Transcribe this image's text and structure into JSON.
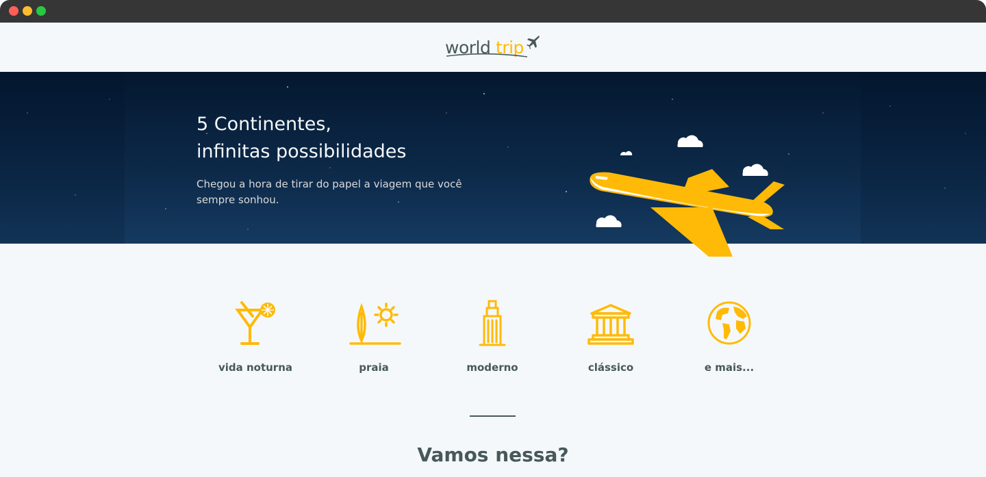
{
  "window": {
    "controls": [
      "close",
      "minimize",
      "maximize"
    ]
  },
  "header": {
    "logo": {
      "part1": "world",
      "part2": "trip",
      "icon": "airplane-icon"
    }
  },
  "hero": {
    "title_line1": "5 Continentes,",
    "title_line2": "infinitas possibilidades",
    "subtitle": "Chegou a hora de tirar do papel a viagem que você sempre sonhou.",
    "illustration": "airplane-illustration"
  },
  "travel_types": [
    {
      "label": "vida noturna",
      "icon": "cocktail-icon"
    },
    {
      "label": "praia",
      "icon": "surfboard-sun-icon"
    },
    {
      "label": "moderno",
      "icon": "skyscraper-icon"
    },
    {
      "label": "clássico",
      "icon": "museum-icon"
    },
    {
      "label": "e mais...",
      "icon": "globe-icon"
    }
  ],
  "cta": {
    "title": "Vamos nessa?"
  },
  "colors": {
    "accent": "#ffba08",
    "text": "#47585b",
    "background": "#f5f8fa",
    "hero_bg": "#0a2442"
  }
}
